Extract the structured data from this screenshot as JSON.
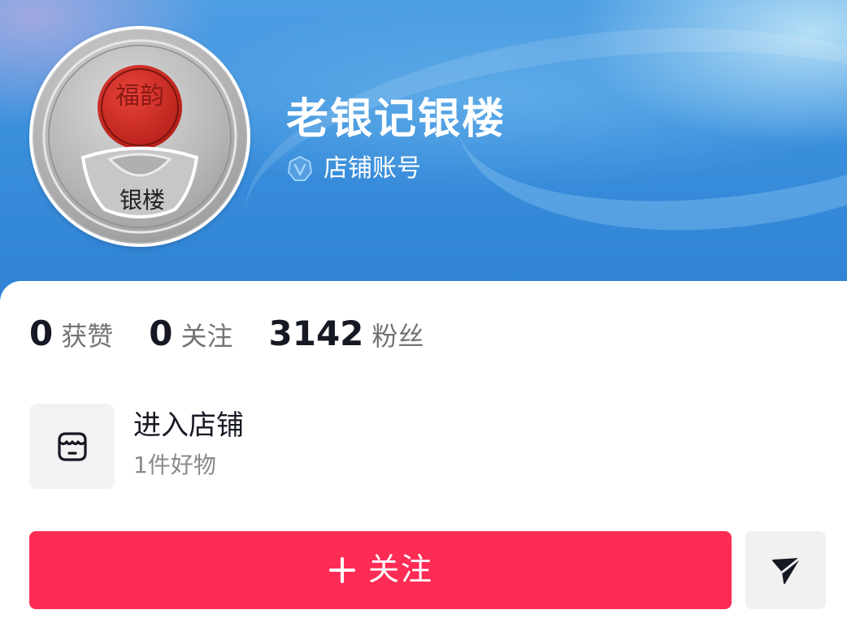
{
  "profile": {
    "name": "老银记银楼",
    "account_type": "店铺账号",
    "avatar_text": "银楼",
    "avatar_seal_text": "福韵"
  },
  "stats": [
    {
      "value": "0",
      "label": "获赞"
    },
    {
      "value": "0",
      "label": "关注"
    },
    {
      "value": "3142",
      "label": "粉丝"
    }
  ],
  "store": {
    "title": "进入店铺",
    "subtitle": "1件好物",
    "icon": "store-icon"
  },
  "actions": {
    "follow_label": "关注",
    "follow_icon": "plus-icon",
    "share_icon": "send-icon"
  },
  "colors": {
    "follow_button": "#fe2c55",
    "banner_blue": "#3a8fdc",
    "primary_text": "#161823",
    "secondary_text": "#737373"
  }
}
